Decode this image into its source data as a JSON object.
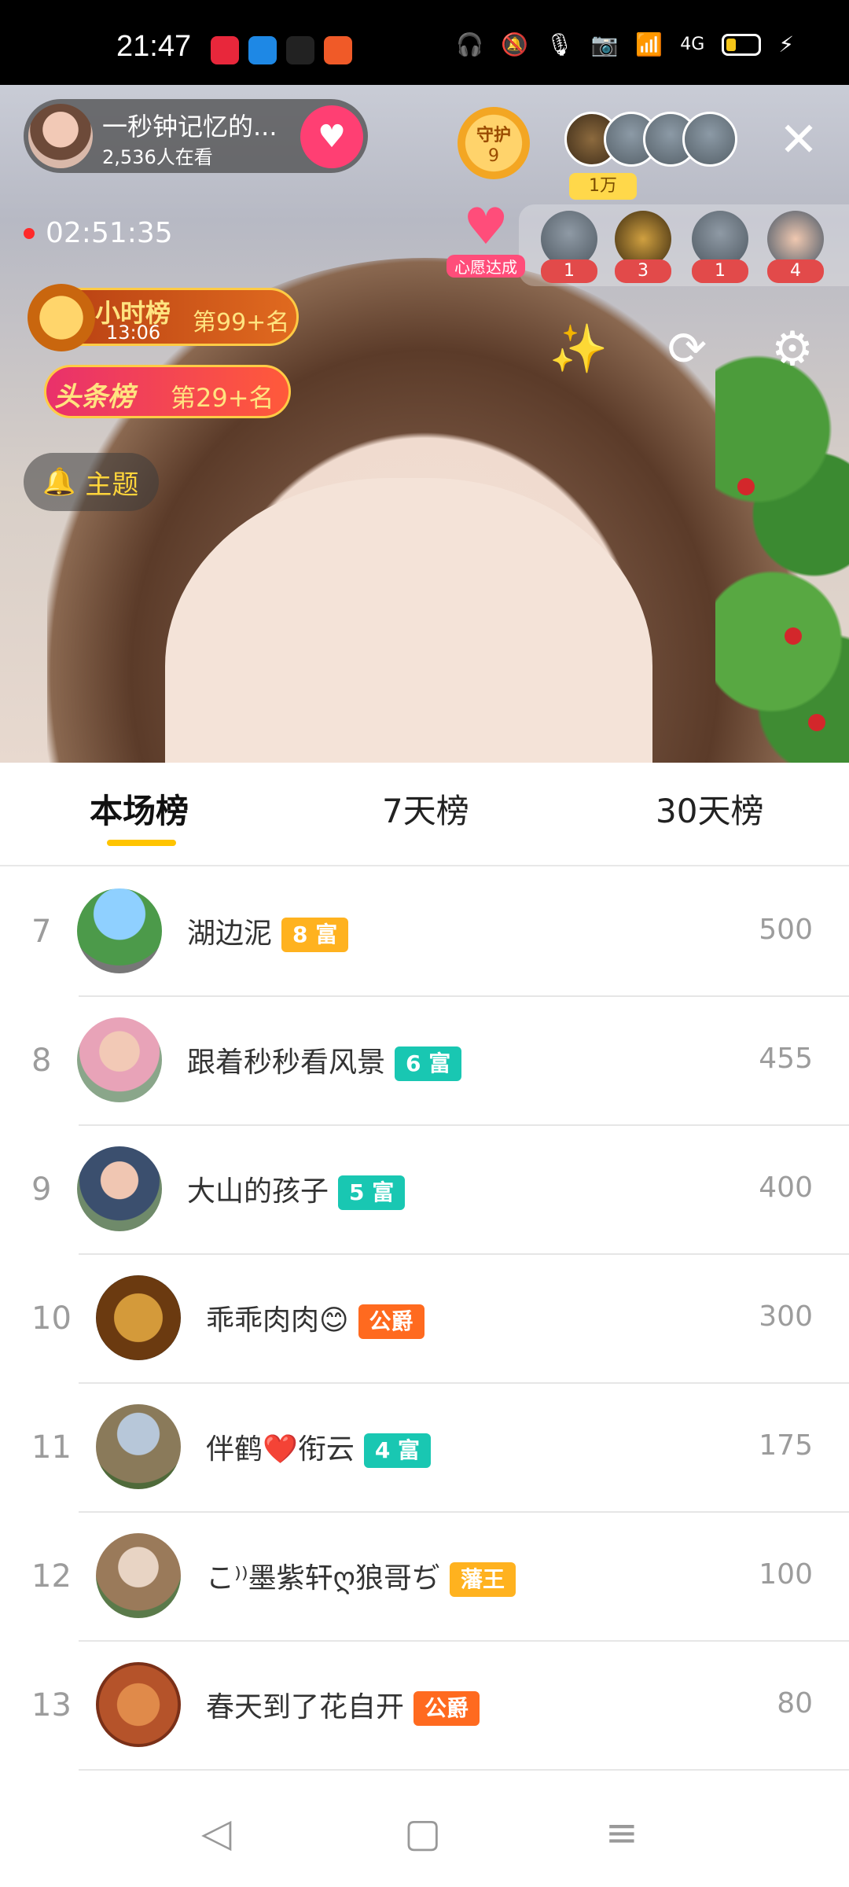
{
  "status_bar": {
    "time": "21:47",
    "app_icons": [
      {
        "icon": "video-app-icon",
        "color": "#e8273b"
      },
      {
        "icon": "browser-app-icon",
        "color": "#1e88e5"
      },
      {
        "icon": "tiktok-app-icon",
        "color": "#111111"
      },
      {
        "icon": "app-icon",
        "color": "#f05a28"
      }
    ],
    "network": "4G"
  },
  "live": {
    "host_name": "一秒钟记忆的...",
    "viewers": "2,536人在看",
    "follow_icon": "heart-plus-icon",
    "guard_label": "守护",
    "guard_count": "9",
    "fans_badge": "1万",
    "record_time": "02:51:35",
    "wish_label": "心愿达成",
    "gifter_counts": [
      "1",
      "3",
      "1",
      "4"
    ],
    "hour_rank_title": "小时榜",
    "hour_rank_time": "13:06",
    "hour_rank_place": "第99+名",
    "headline_rank_title": "头条榜",
    "headline_rank_place": "第29+名",
    "topic_label": "主题"
  },
  "tabs": [
    {
      "label": "本场榜",
      "active": true
    },
    {
      "label": "7天榜",
      "active": false
    },
    {
      "label": "30天榜",
      "active": false
    }
  ],
  "leaderboard": [
    {
      "rank": "7",
      "name": "湖边泥",
      "badge": "8 富",
      "badge_color": "#ffb21f",
      "score": "500"
    },
    {
      "rank": "8",
      "name": "跟着秒秒看风景",
      "badge": "6 富",
      "badge_color": "#19c7b2",
      "score": "455"
    },
    {
      "rank": "9",
      "name": "大山的孩子",
      "badge": "5 富",
      "badge_color": "#19c7b2",
      "score": "400"
    },
    {
      "rank": "10",
      "name": "乖乖肉肉😊",
      "badge": "公爵",
      "badge_color": "#ff6a1f",
      "score": "300"
    },
    {
      "rank": "11",
      "name": "伴鹤❤️衔云",
      "badge": "4 富",
      "badge_color": "#19c7b2",
      "score": "175"
    },
    {
      "rank": "12",
      "name": "こ⁾⁾墨紫轩ღ狼哥ぢ",
      "badge": "藩王",
      "badge_color": "#ffb21f",
      "score": "100"
    },
    {
      "rank": "13",
      "name": "春天到了花自开",
      "badge": "公爵",
      "badge_color": "#ff6a1f",
      "score": "80"
    }
  ]
}
